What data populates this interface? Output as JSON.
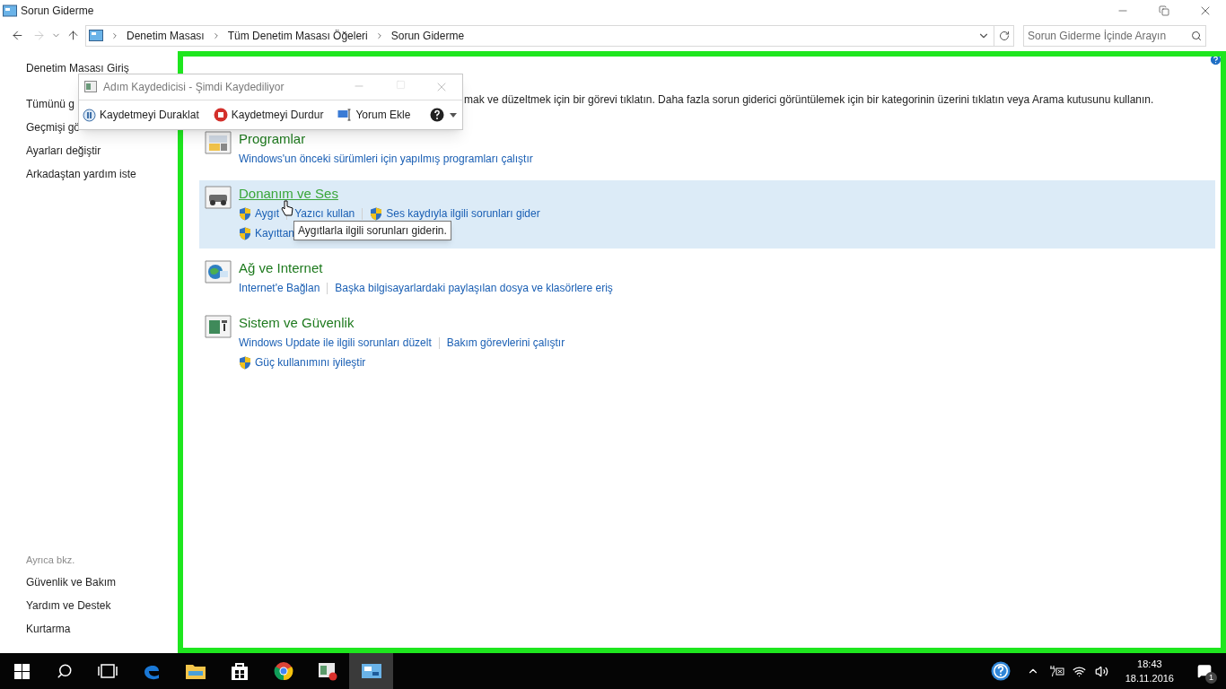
{
  "window": {
    "title": "Sorun Giderme"
  },
  "address": {
    "crumbs": [
      "Denetim Masası",
      "Tüm Denetim Masası Öğeleri",
      "Sorun Giderme"
    ]
  },
  "search": {
    "placeholder": "Sorun Giderme İçinde Arayın"
  },
  "sidebar": {
    "items": [
      "Denetim Masası Giriş",
      "Tümünü g",
      "Geçmişi gö",
      "Ayarları değiştir",
      "Arkadaştan yardım iste"
    ],
    "see_also_title": "Ayrıca bkz.",
    "see_also": [
      "Güvenlik ve Bakım",
      "Yardım ve Destek",
      "Kurtarma"
    ]
  },
  "description": "mak ve düzeltmek için bir görevi tıklatın. Daha fazla sorun giderici görüntülemek için bir kategorinin üzerini tıklatın veya Arama kutusunu kullanın.",
  "categories": [
    {
      "kind": "programs",
      "title": "Programlar",
      "hovered": false,
      "lines": [
        [
          {
            "text": "Windows'un önceki sürümleri için yapılmış programları çalıştır",
            "shield": false
          }
        ]
      ]
    },
    {
      "kind": "hardware",
      "title": "Donanım ve Ses",
      "hovered": true,
      "lines": [
        [
          {
            "text": "Aygıt",
            "shield": true
          },
          {
            "text": "Yazıcı kullan",
            "shield": false
          },
          {
            "text": "Ses kaydıyla ilgili sorunları gider",
            "shield": true
          }
        ],
        [
          {
            "text": "Kayıttan",
            "shield": true
          }
        ]
      ]
    },
    {
      "kind": "network",
      "title": "Ağ ve Internet",
      "hovered": false,
      "lines": [
        [
          {
            "text": "Internet'e Bağlan",
            "shield": false
          },
          {
            "text": "Başka bilgisayarlardaki paylaşılan dosya ve klasörlere eriş",
            "shield": false
          }
        ]
      ]
    },
    {
      "kind": "system",
      "title": "Sistem ve Güvenlik",
      "hovered": false,
      "lines": [
        [
          {
            "text": "Windows Update ile ilgili sorunları düzelt",
            "shield": false
          },
          {
            "text": "Bakım görevlerini çalıştır",
            "shield": false
          }
        ],
        [
          {
            "text": "Güç kullanımını iyileştir",
            "shield": true
          }
        ]
      ]
    }
  ],
  "tooltip": "Aygıtlarla ilgili sorunları giderin.",
  "recorder": {
    "title": "Adım Kaydedicisi - Şimdi Kaydediliyor",
    "buttons": [
      {
        "kind": "pause",
        "label": "Kaydetmeyi Duraklat"
      },
      {
        "kind": "stop",
        "label": "Kaydetmeyi Durdur"
      },
      {
        "kind": "comment",
        "label": "Yorum Ekle"
      }
    ]
  },
  "taskbar": {
    "apps": [
      {
        "kind": "edge",
        "active": false
      },
      {
        "kind": "folder",
        "active": false
      },
      {
        "kind": "store",
        "active": false
      },
      {
        "kind": "chrome",
        "active": false
      },
      {
        "kind": "recorder",
        "active": false
      },
      {
        "kind": "panel",
        "active": true
      }
    ],
    "time": "18:43",
    "date": "18.11.2016",
    "notifications": "1"
  }
}
